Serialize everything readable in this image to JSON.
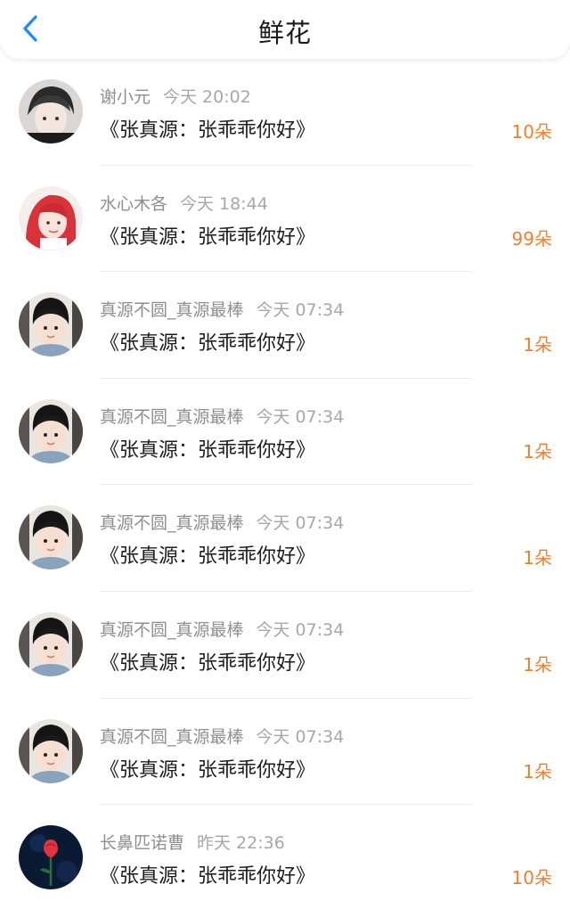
{
  "header": {
    "title": "鲜花",
    "back_icon": "chevron-left-icon",
    "accent": "#1a8cff"
  },
  "colors": {
    "count": "#f07f2c",
    "meta": "#8e8e93"
  },
  "items": [
    {
      "user": "谢小元",
      "time": "今天 20:02",
      "message": "《张真源：张乖乖你好》",
      "count": "10朵",
      "avatar": "avatar-girl-gray"
    },
    {
      "user": "水心木各",
      "time": "今天 18:44",
      "message": "《张真源：张乖乖你好》",
      "count": "99朵",
      "avatar": "avatar-red-hair"
    },
    {
      "user": "真源不圆_真源最棒",
      "time": "今天 07:34",
      "message": "《张真源：张乖乖你好》",
      "count": "1朵",
      "avatar": "avatar-boy"
    },
    {
      "user": "真源不圆_真源最棒",
      "time": "今天 07:34",
      "message": "《张真源：张乖乖你好》",
      "count": "1朵",
      "avatar": "avatar-boy"
    },
    {
      "user": "真源不圆_真源最棒",
      "time": "今天 07:34",
      "message": "《张真源：张乖乖你好》",
      "count": "1朵",
      "avatar": "avatar-boy"
    },
    {
      "user": "真源不圆_真源最棒",
      "time": "今天 07:34",
      "message": "《张真源：张乖乖你好》",
      "count": "1朵",
      "avatar": "avatar-boy"
    },
    {
      "user": "真源不圆_真源最棒",
      "time": "今天 07:34",
      "message": "《张真源：张乖乖你好》",
      "count": "1朵",
      "avatar": "avatar-boy"
    },
    {
      "user": "长鼻匹诺曹",
      "time": "昨天 22:36",
      "message": "《张真源：张乖乖你好》",
      "count": "10朵",
      "avatar": "avatar-rose"
    }
  ]
}
